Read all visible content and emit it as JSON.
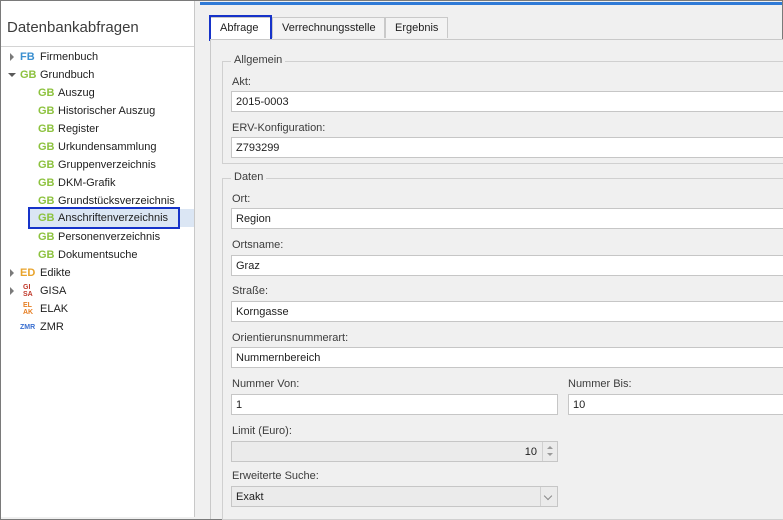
{
  "sidebar": {
    "title": "Datenbankabfragen",
    "items": [
      {
        "badge": "FB",
        "label": "Firmenbuch"
      },
      {
        "badge": "GB",
        "label": "Grundbuch"
      },
      {
        "badge": "GB",
        "label": "Auszug"
      },
      {
        "badge": "GB",
        "label": "Historischer Auszug"
      },
      {
        "badge": "GB",
        "label": "Register"
      },
      {
        "badge": "GB",
        "label": "Urkundensammlung"
      },
      {
        "badge": "GB",
        "label": "Gruppenverzeichnis"
      },
      {
        "badge": "GB",
        "label": "DKM-Grafik"
      },
      {
        "badge": "GB",
        "label": "Grundstücksverzeichnis"
      },
      {
        "badge": "GB",
        "label": "Anschriftenverzeichnis"
      },
      {
        "badge": "GB",
        "label": "Personenverzeichnis"
      },
      {
        "badge": "GB",
        "label": "Dokumentsuche"
      },
      {
        "badge": "ED",
        "label": "Edikte"
      },
      {
        "badge": "GI SA",
        "badge_top": "GI",
        "badge_bottom": "SA",
        "label": "GISA"
      },
      {
        "badge": "EL AK",
        "badge_top": "EL",
        "badge_bottom": "AK",
        "label": "ELAK"
      },
      {
        "badge": "ZMR",
        "label": "ZMR"
      }
    ],
    "selected": "Anschriftenverzeichnis"
  },
  "tabs": [
    {
      "label": "Abfrage",
      "active": true
    },
    {
      "label": "Verrechnungsstelle",
      "active": false
    },
    {
      "label": "Ergebnis",
      "active": false
    }
  ],
  "form": {
    "allgemein": {
      "title": "Allgemein",
      "akt_label": "Akt:",
      "akt_value": "2015-0003",
      "erv_label": "ERV-Konfiguration:",
      "erv_value": "Z793299"
    },
    "daten": {
      "title": "Daten",
      "ort_label": "Ort:",
      "ort_value": "Region",
      "ortsname_label": "Ortsname:",
      "ortsname_value": "Graz",
      "strasse_label": "Straße:",
      "strasse_value": "Korngasse",
      "orient_label": "Orientierunsnummerart:",
      "orient_value": "Nummernbereich",
      "nummer_von_label": "Nummer Von:",
      "nummer_von_value": "1",
      "nummer_bis_label": "Nummer Bis:",
      "nummer_bis_value": "10",
      "limit_label": "Limit (Euro):",
      "limit_value": "10",
      "erweitert_label": "Erweiterte Suche:",
      "erweitert_value": "Exakt"
    }
  },
  "colors": {
    "accent": "#2f7ad6",
    "highlight_box": "#1633c9",
    "selection_bg": "#dbe6f4",
    "badge_fb": "#3a8fd0",
    "badge_gb": "#8dc23f",
    "badge_ed": "#e8a32b"
  }
}
